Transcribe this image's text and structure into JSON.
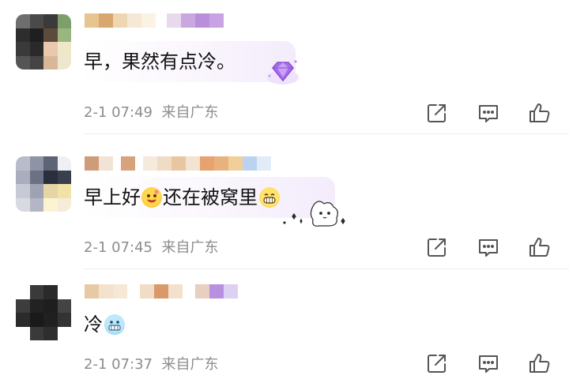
{
  "comments": [
    {
      "text": "早，果然有点冷。",
      "time": "2-1 07:49",
      "location": "来自广东",
      "emojis": [],
      "decoration_icon": "purple-gem-badge-icon"
    },
    {
      "text_before": "早上好",
      "text_after": "还在被窝里",
      "time": "2-1 07:45",
      "location": "来自广东",
      "emojis": [
        "sun-smile-emoji-icon",
        "grin-emoji-icon"
      ],
      "decoration_icon": "cute-bear-sticker-icon"
    },
    {
      "text": "冷",
      "time": "2-1 07:37",
      "location": "来自广东",
      "emojis": [
        "freezing-face-emoji-icon"
      ]
    }
  ],
  "actions": [
    "share-icon",
    "comment-icon",
    "like-icon"
  ],
  "colors": {
    "meta_text": "#8c8c8c",
    "icon_stroke": "#555555",
    "divider": "#ececec",
    "bubble_tint": "#f3ecfb"
  }
}
